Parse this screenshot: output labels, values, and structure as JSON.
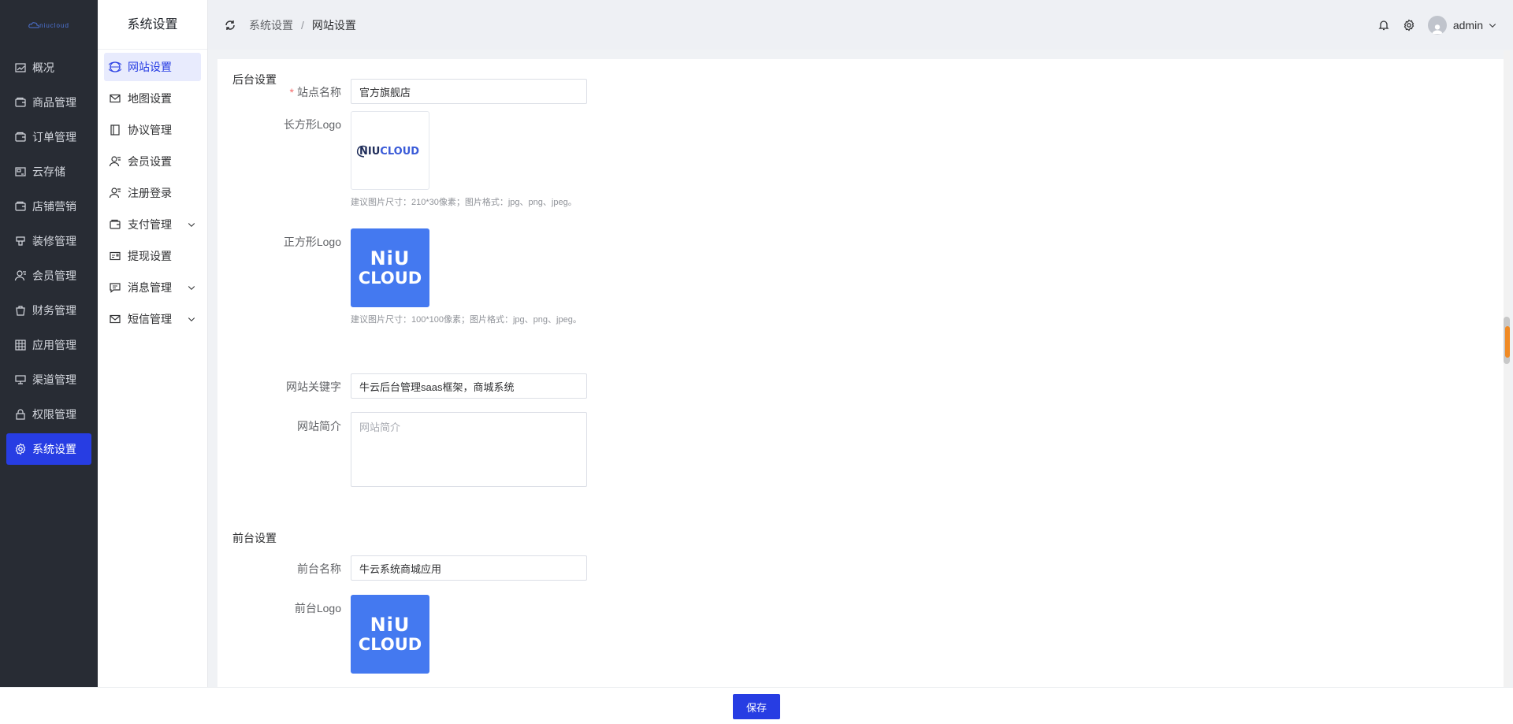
{
  "app": {
    "logo_text": "niucloud"
  },
  "sidebar": {
    "items": [
      {
        "label": "概况",
        "icon": "trend-chart-icon"
      },
      {
        "label": "商品管理",
        "icon": "wallet-icon"
      },
      {
        "label": "订单管理",
        "icon": "wallet-icon"
      },
      {
        "label": "云存储",
        "icon": "storage-icon"
      },
      {
        "label": "店铺营销",
        "icon": "wallet-icon"
      },
      {
        "label": "装修管理",
        "icon": "brush-icon"
      },
      {
        "label": "会员管理",
        "icon": "user-icon"
      },
      {
        "label": "财务管理",
        "icon": "bag-icon"
      },
      {
        "label": "应用管理",
        "icon": "grid-icon"
      },
      {
        "label": "渠道管理",
        "icon": "monitor-icon"
      },
      {
        "label": "权限管理",
        "icon": "lock-icon"
      },
      {
        "label": "系统设置",
        "icon": "gear-icon",
        "active": true
      }
    ]
  },
  "subnav": {
    "title": "系统设置",
    "items": [
      {
        "label": "网站设置",
        "icon": "globe-icon",
        "active": true
      },
      {
        "label": "地图设置",
        "icon": "mail-icon"
      },
      {
        "label": "协议管理",
        "icon": "notebook-icon"
      },
      {
        "label": "会员设置",
        "icon": "user-icon"
      },
      {
        "label": "注册登录",
        "icon": "user-icon"
      },
      {
        "label": "支付管理",
        "icon": "wallet-icon",
        "expandable": true
      },
      {
        "label": "提现设置",
        "icon": "postcard-icon"
      },
      {
        "label": "消息管理",
        "icon": "chat-icon",
        "expandable": true
      },
      {
        "label": "短信管理",
        "icon": "mail-icon",
        "expandable": true
      }
    ]
  },
  "header": {
    "breadcrumb": [
      "系统设置",
      "网站设置"
    ],
    "separator": "/",
    "username": "admin"
  },
  "backend": {
    "section_title": "后台设置",
    "site_name_label": "站点名称",
    "site_name_value": "官方旗舰店",
    "rect_logo_label": "长方形Logo",
    "rect_logo_text_a": "NIU",
    "rect_logo_text_b": "CLOUD",
    "rect_logo_hint": "建议图片尺寸：210*30像素；图片格式：jpg、png、jpeg。",
    "square_logo_label": "正方形Logo",
    "square_logo_line1": "NiU",
    "square_logo_line2": "CLOUD",
    "square_logo_hint": "建议图片尺寸：100*100像素；图片格式：jpg、png、jpeg。",
    "keywords_label": "网站关键字",
    "keywords_value": "牛云后台管理saas框架，商城系统",
    "desc_label": "网站简介",
    "desc_placeholder": "网站简介"
  },
  "frontend": {
    "section_title": "前台设置",
    "name_label": "前台名称",
    "name_value": "牛云系统商城应用",
    "logo_label": "前台Logo",
    "logo_line1": "NiU",
    "logo_line2": "CLOUD"
  },
  "footer": {
    "save_label": "保存"
  },
  "colors": {
    "primary": "#273de3",
    "sidebar_bg": "#282c34",
    "logo_blue": "#4479f0"
  }
}
